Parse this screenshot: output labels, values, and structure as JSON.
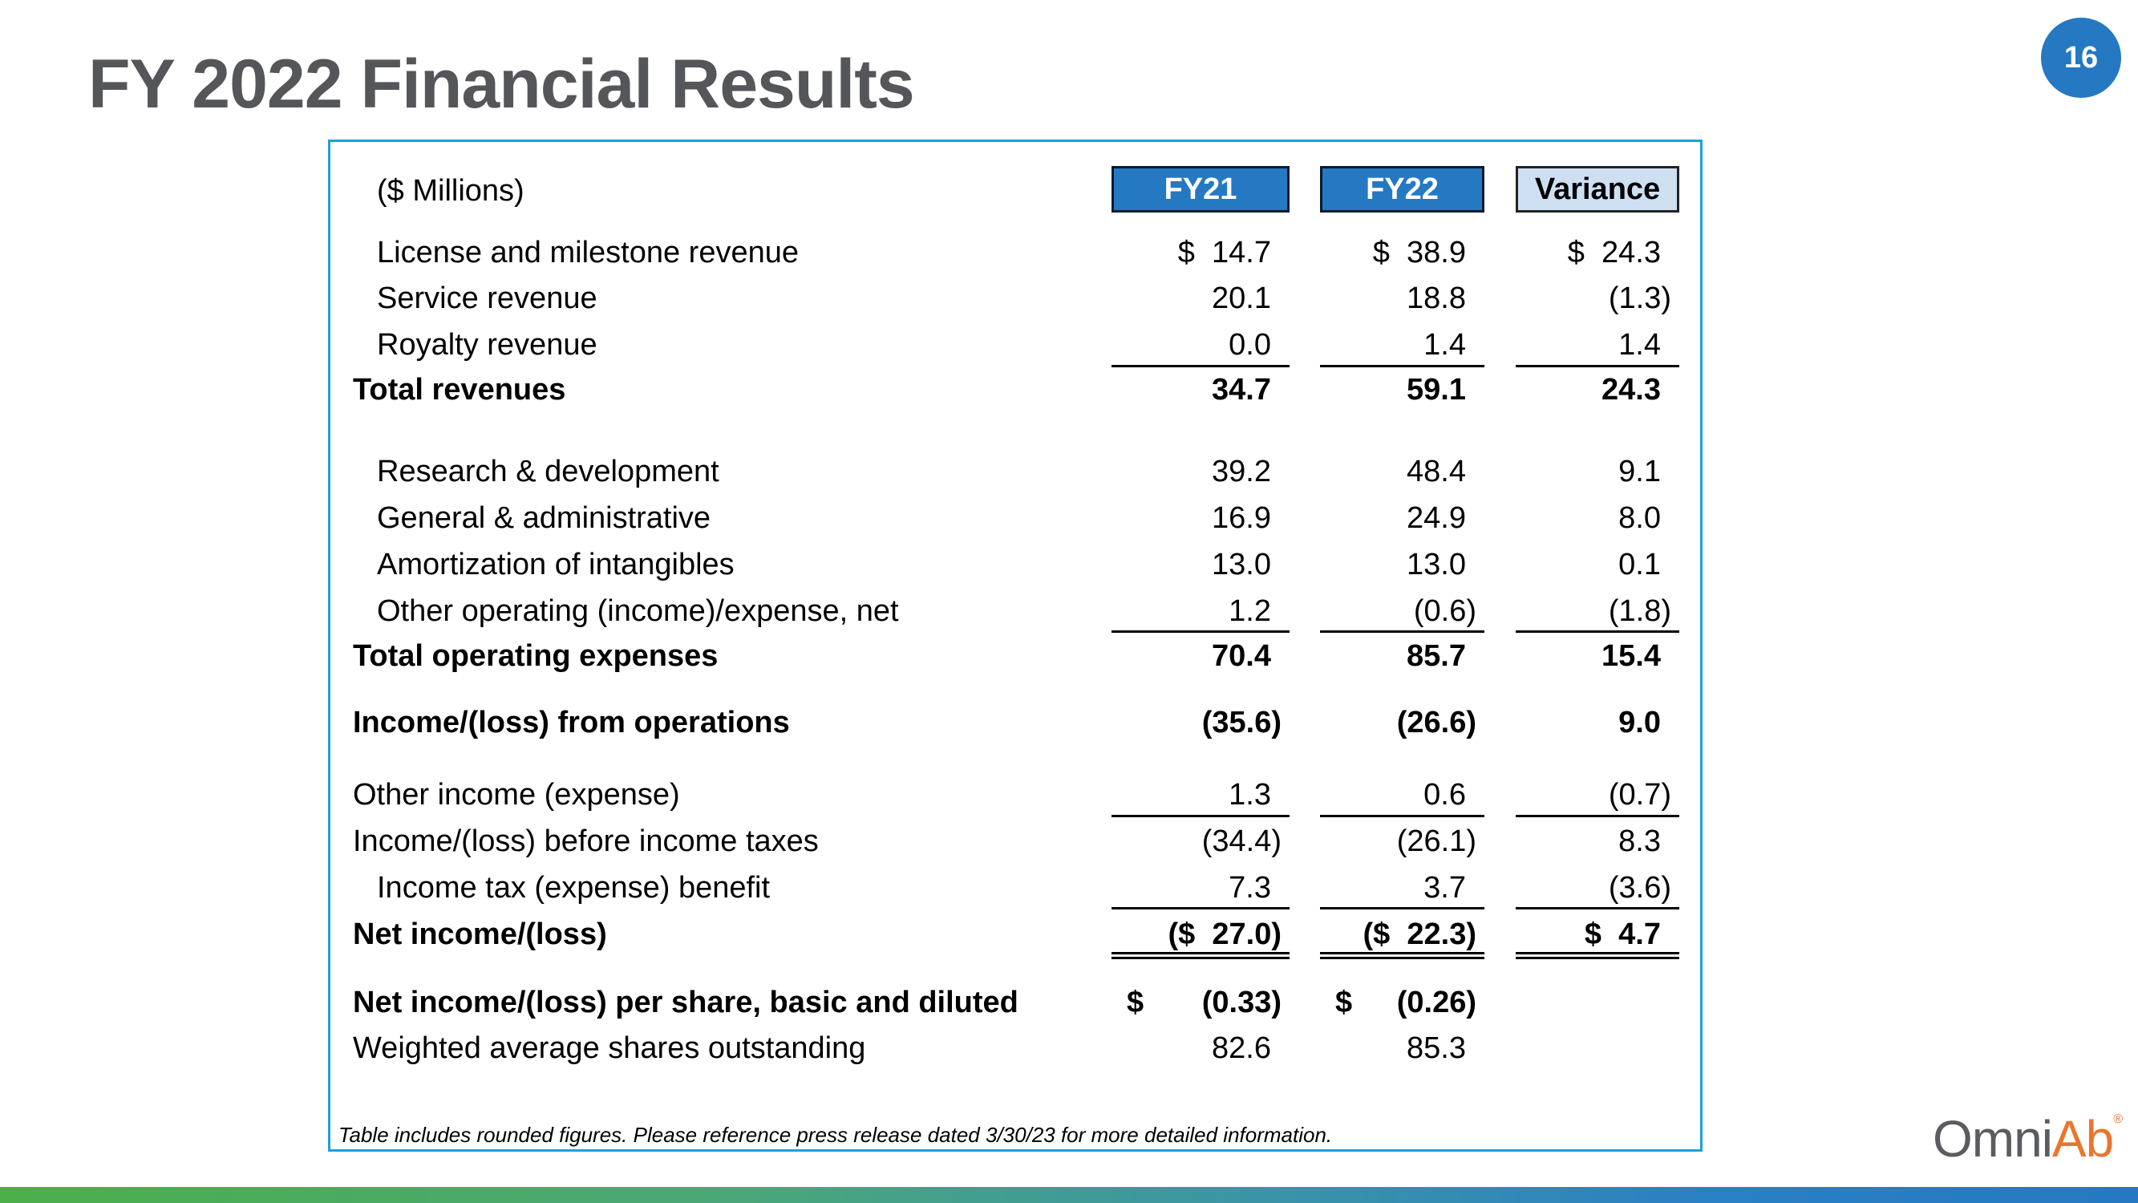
{
  "slide": {
    "title": "FY 2022 Financial Results",
    "page_number": "16",
    "footnote": "Table includes rounded figures.  Please reference press release dated 3/30/23 for more detailed information.",
    "logo": {
      "part1": "Omni",
      "part2": "Ab",
      "mark": "®"
    },
    "colors": {
      "header_dark": "#2479c2",
      "header_light": "#cfdff2",
      "panel_border": "#1ba1dd",
      "title": "#54565a",
      "logo_orange": "#e8772e"
    }
  },
  "table": {
    "units_label": "($ Millions)",
    "columns": [
      "FY21",
      "FY22",
      "Variance"
    ],
    "rows": [
      {
        "label": "License and milestone revenue",
        "fy21": "$  14.7",
        "fy22": "$  38.9",
        "variance": "$  24.3"
      },
      {
        "label": "Service revenue",
        "fy21": "20.1",
        "fy22": "18.8",
        "variance": "(1.3)"
      },
      {
        "label": "Royalty revenue",
        "fy21": "0.0",
        "fy22": "1.4",
        "variance": "1.4"
      },
      {
        "label": "Total revenues",
        "fy21": "34.7",
        "fy22": "59.1",
        "variance": "24.3"
      },
      {
        "label": "Research & development",
        "fy21": "39.2",
        "fy22": "48.4",
        "variance": "9.1"
      },
      {
        "label": "General & administrative",
        "fy21": "16.9",
        "fy22": "24.9",
        "variance": "8.0"
      },
      {
        "label": "Amortization of intangibles",
        "fy21": "13.0",
        "fy22": "13.0",
        "variance": "0.1"
      },
      {
        "label": "Other operating (income)/expense, net",
        "fy21": "1.2",
        "fy22": "(0.6)",
        "variance": "(1.8)"
      },
      {
        "label": "Total operating expenses",
        "fy21": "70.4",
        "fy22": "85.7",
        "variance": "15.4"
      },
      {
        "label": "Income/(loss) from operations",
        "fy21": "(35.6)",
        "fy22": "(26.6)",
        "variance": "9.0"
      },
      {
        "label": "Other income (expense)",
        "fy21": "1.3",
        "fy22": "0.6",
        "variance": "(0.7)"
      },
      {
        "label": "Income/(loss) before income taxes",
        "fy21": "(34.4)",
        "fy22": "(26.1)",
        "variance": "8.3"
      },
      {
        "label": "Income tax (expense) benefit",
        "fy21": "7.3",
        "fy22": "3.7",
        "variance": "(3.6)"
      },
      {
        "label": "Net income/(loss)",
        "fy21": "($  27.0)",
        "fy22": "($  22.3)",
        "variance": "$  4.7"
      },
      {
        "label": "Net income/(loss) per share, basic and diluted",
        "fy21_currency": "$",
        "fy21": "(0.33)",
        "fy22_currency": "$",
        "fy22": "(0.26)",
        "variance": ""
      },
      {
        "label": "Weighted average shares outstanding",
        "fy21": "82.6",
        "fy22": "85.3",
        "variance": ""
      }
    ]
  }
}
